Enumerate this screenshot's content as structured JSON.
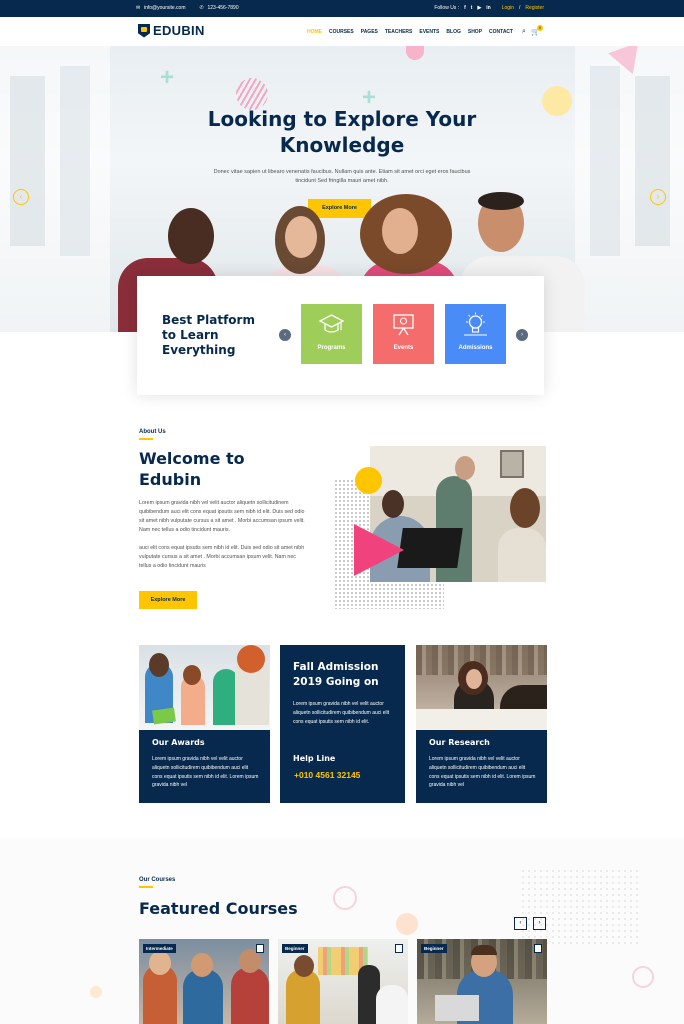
{
  "topbar": {
    "email": "info@yoursite.com",
    "phone": "123-456-7890",
    "follow_label": "Follow Us :",
    "login": "Login",
    "separator": "/",
    "register": "Register"
  },
  "nav": {
    "logo": "EDUBIN",
    "items": [
      "HOME",
      "COURSES",
      "PAGES",
      "TEACHERS",
      "EVENTS",
      "BLOG",
      "SHOP",
      "CONTACT"
    ],
    "cart_count": "0"
  },
  "hero": {
    "title_line1": "Looking to Explore Your",
    "title_line2": "Knowledge",
    "text": "Donec vitae sapien ut libearo venenatis faucibus. Nullam quis ante. Etiam sit amet orci eget eros faucibus tincidunt Sed fringilla mauri amet nibh.",
    "button": "Explore More"
  },
  "platform": {
    "title": "Best Platform to Learn Everything",
    "cards": [
      {
        "label": "Programs",
        "color": "#9fcd59",
        "icon": "graduation-cap-icon"
      },
      {
        "label": "Events",
        "color": "#f56c6c",
        "icon": "presentation-icon"
      },
      {
        "label": "Admissions",
        "color": "#4a8cf7",
        "icon": "lightbulb-icon"
      }
    ]
  },
  "about": {
    "label": "About Us",
    "title": "Welcome to Edubin",
    "para1": "Lorem ipsum gravida nibh vel velit auctor aliquetn sollicitudinem quibibendum auci elit cons equat ipsutis sem nibh id elit. Duis sed odio sit amet nibh vulputate cursus a sit amet . Morbi accumsan ipsum velit. Nam nec tellus a odio tincidunt mauris.",
    "para2": "auci elit cons equat ipsutis sem nibh id elit. Duis sed odio sit amet nibh vulputate cursus a sit amet . Morbi accumsan ipsum velit. Nam nec tellus a odio tincidunt mauris",
    "button": "Explore More"
  },
  "features": {
    "awards": {
      "title": "Our Awards",
      "text": "Lorem ipsum gravida nibh vel velit auctor aliquetn sollicitudirem quibibendum auci elit cons equat ipsutis sem nibh id elit. Lorem ipsum gravida nibh vel"
    },
    "admission": {
      "title": "Fall Admission 2019 Going on",
      "text": "Lorem ipsum gravida nibh vel velit auctor aliquetn sollicitudirem quibibendum auci elit cons equat ipsutis sem nibh id elit.",
      "help": "Help Line",
      "phone": "+010 4561 32145"
    },
    "research": {
      "title": "Our Research",
      "text": "Lorem ipsum gravida nibh vel velit auctor aliquetn sollicitudirem quibibendum auci elit cons equat ipsutis sem nibh id elit. Lorem ipsum gravida nibh vel"
    }
  },
  "courses": {
    "label": "Our Courses",
    "title": "Featured Courses",
    "items": [
      {
        "level": "Intermediate"
      },
      {
        "level": "Beginner"
      },
      {
        "level": "Beginner"
      }
    ]
  },
  "colors": {
    "navy": "#07294d",
    "yellow": "#ffc600"
  }
}
